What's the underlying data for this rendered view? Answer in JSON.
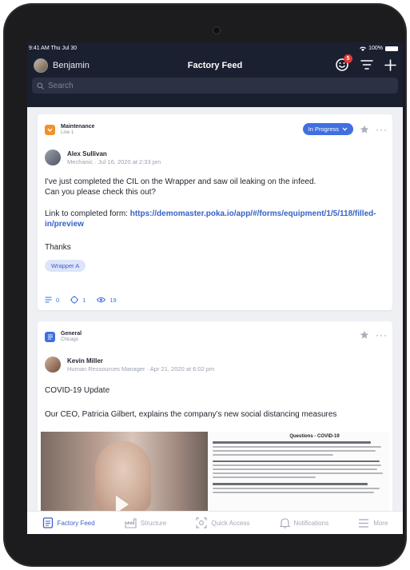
{
  "status_bar": {
    "time": "9:41 AM  Thu Jul 30",
    "battery": "100%"
  },
  "header": {
    "user_name": "Benjamin",
    "title": "Factory Feed",
    "notification_count": "5",
    "accent_color": "#1b2030"
  },
  "search": {
    "placeholder": "Search"
  },
  "posts": [
    {
      "category": "Maintenance",
      "subcategory": "Line 1",
      "category_color": "#f0922c",
      "status": "In Progress",
      "status_color": "#3f6fe0",
      "author": "Alex Sullivan",
      "author_meta": "Mechanic · Jul 16, 2020 at 2:33 pm",
      "body_line1": "I've just completed the CIL on the Wrapper and saw oil leaking on the infeed.",
      "body_line2": "Can you please check this out?",
      "link_prefix": "Link to completed form: ",
      "link_text": "https://demomaster.poka.io/app/#/forms/equipment/1/5/118/filled-in/preview",
      "thanks": "Thanks",
      "tag": "Wrapper A",
      "comments": "0",
      "reactions": "1",
      "views": "19"
    },
    {
      "category": "General",
      "subcategory": "Chicago",
      "category_color": "#3f6fe0",
      "author": "Kevin Miller",
      "author_meta": "Human Ressources Manager · Apr 21, 2020 at 6:02 pm",
      "headline": "COVID-19 Update",
      "body": "Our CEO, Patricia Gilbert, explains the company's new social distancing measures",
      "doc_title": "Questions - COVID-19"
    }
  ],
  "tabs": [
    {
      "label": "Factory Feed",
      "icon": "feed-icon",
      "active": true
    },
    {
      "label": "Structure",
      "icon": "factory-icon",
      "active": false
    },
    {
      "label": "Quick Access",
      "icon": "scan-icon",
      "active": false
    },
    {
      "label": "Notifications",
      "icon": "bell-icon",
      "active": false
    },
    {
      "label": "More",
      "icon": "menu-icon",
      "active": false
    }
  ]
}
